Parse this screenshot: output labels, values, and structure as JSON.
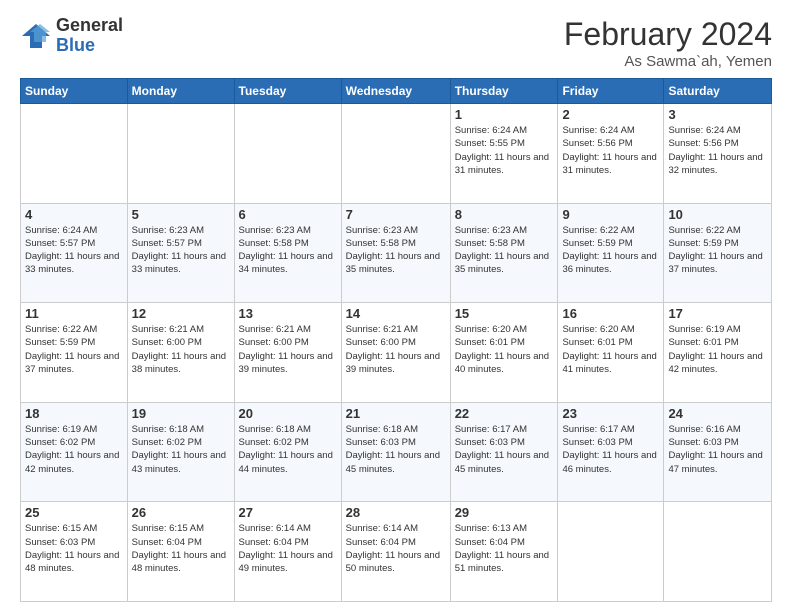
{
  "logo": {
    "general": "General",
    "blue": "Blue"
  },
  "header": {
    "month_year": "February 2024",
    "location": "As Sawma`ah, Yemen"
  },
  "days_of_week": [
    "Sunday",
    "Monday",
    "Tuesday",
    "Wednesday",
    "Thursday",
    "Friday",
    "Saturday"
  ],
  "weeks": [
    [
      {
        "day": "",
        "info": ""
      },
      {
        "day": "",
        "info": ""
      },
      {
        "day": "",
        "info": ""
      },
      {
        "day": "",
        "info": ""
      },
      {
        "day": "1",
        "info": "Sunrise: 6:24 AM\nSunset: 5:55 PM\nDaylight: 11 hours and 31 minutes."
      },
      {
        "day": "2",
        "info": "Sunrise: 6:24 AM\nSunset: 5:56 PM\nDaylight: 11 hours and 31 minutes."
      },
      {
        "day": "3",
        "info": "Sunrise: 6:24 AM\nSunset: 5:56 PM\nDaylight: 11 hours and 32 minutes."
      }
    ],
    [
      {
        "day": "4",
        "info": "Sunrise: 6:24 AM\nSunset: 5:57 PM\nDaylight: 11 hours and 33 minutes."
      },
      {
        "day": "5",
        "info": "Sunrise: 6:23 AM\nSunset: 5:57 PM\nDaylight: 11 hours and 33 minutes."
      },
      {
        "day": "6",
        "info": "Sunrise: 6:23 AM\nSunset: 5:58 PM\nDaylight: 11 hours and 34 minutes."
      },
      {
        "day": "7",
        "info": "Sunrise: 6:23 AM\nSunset: 5:58 PM\nDaylight: 11 hours and 35 minutes."
      },
      {
        "day": "8",
        "info": "Sunrise: 6:23 AM\nSunset: 5:58 PM\nDaylight: 11 hours and 35 minutes."
      },
      {
        "day": "9",
        "info": "Sunrise: 6:22 AM\nSunset: 5:59 PM\nDaylight: 11 hours and 36 minutes."
      },
      {
        "day": "10",
        "info": "Sunrise: 6:22 AM\nSunset: 5:59 PM\nDaylight: 11 hours and 37 minutes."
      }
    ],
    [
      {
        "day": "11",
        "info": "Sunrise: 6:22 AM\nSunset: 5:59 PM\nDaylight: 11 hours and 37 minutes."
      },
      {
        "day": "12",
        "info": "Sunrise: 6:21 AM\nSunset: 6:00 PM\nDaylight: 11 hours and 38 minutes."
      },
      {
        "day": "13",
        "info": "Sunrise: 6:21 AM\nSunset: 6:00 PM\nDaylight: 11 hours and 39 minutes."
      },
      {
        "day": "14",
        "info": "Sunrise: 6:21 AM\nSunset: 6:00 PM\nDaylight: 11 hours and 39 minutes."
      },
      {
        "day": "15",
        "info": "Sunrise: 6:20 AM\nSunset: 6:01 PM\nDaylight: 11 hours and 40 minutes."
      },
      {
        "day": "16",
        "info": "Sunrise: 6:20 AM\nSunset: 6:01 PM\nDaylight: 11 hours and 41 minutes."
      },
      {
        "day": "17",
        "info": "Sunrise: 6:19 AM\nSunset: 6:01 PM\nDaylight: 11 hours and 42 minutes."
      }
    ],
    [
      {
        "day": "18",
        "info": "Sunrise: 6:19 AM\nSunset: 6:02 PM\nDaylight: 11 hours and 42 minutes."
      },
      {
        "day": "19",
        "info": "Sunrise: 6:18 AM\nSunset: 6:02 PM\nDaylight: 11 hours and 43 minutes."
      },
      {
        "day": "20",
        "info": "Sunrise: 6:18 AM\nSunset: 6:02 PM\nDaylight: 11 hours and 44 minutes."
      },
      {
        "day": "21",
        "info": "Sunrise: 6:18 AM\nSunset: 6:03 PM\nDaylight: 11 hours and 45 minutes."
      },
      {
        "day": "22",
        "info": "Sunrise: 6:17 AM\nSunset: 6:03 PM\nDaylight: 11 hours and 45 minutes."
      },
      {
        "day": "23",
        "info": "Sunrise: 6:17 AM\nSunset: 6:03 PM\nDaylight: 11 hours and 46 minutes."
      },
      {
        "day": "24",
        "info": "Sunrise: 6:16 AM\nSunset: 6:03 PM\nDaylight: 11 hours and 47 minutes."
      }
    ],
    [
      {
        "day": "25",
        "info": "Sunrise: 6:15 AM\nSunset: 6:03 PM\nDaylight: 11 hours and 48 minutes."
      },
      {
        "day": "26",
        "info": "Sunrise: 6:15 AM\nSunset: 6:04 PM\nDaylight: 11 hours and 48 minutes."
      },
      {
        "day": "27",
        "info": "Sunrise: 6:14 AM\nSunset: 6:04 PM\nDaylight: 11 hours and 49 minutes."
      },
      {
        "day": "28",
        "info": "Sunrise: 6:14 AM\nSunset: 6:04 PM\nDaylight: 11 hours and 50 minutes."
      },
      {
        "day": "29",
        "info": "Sunrise: 6:13 AM\nSunset: 6:04 PM\nDaylight: 11 hours and 51 minutes."
      },
      {
        "day": "",
        "info": ""
      },
      {
        "day": "",
        "info": ""
      }
    ]
  ]
}
